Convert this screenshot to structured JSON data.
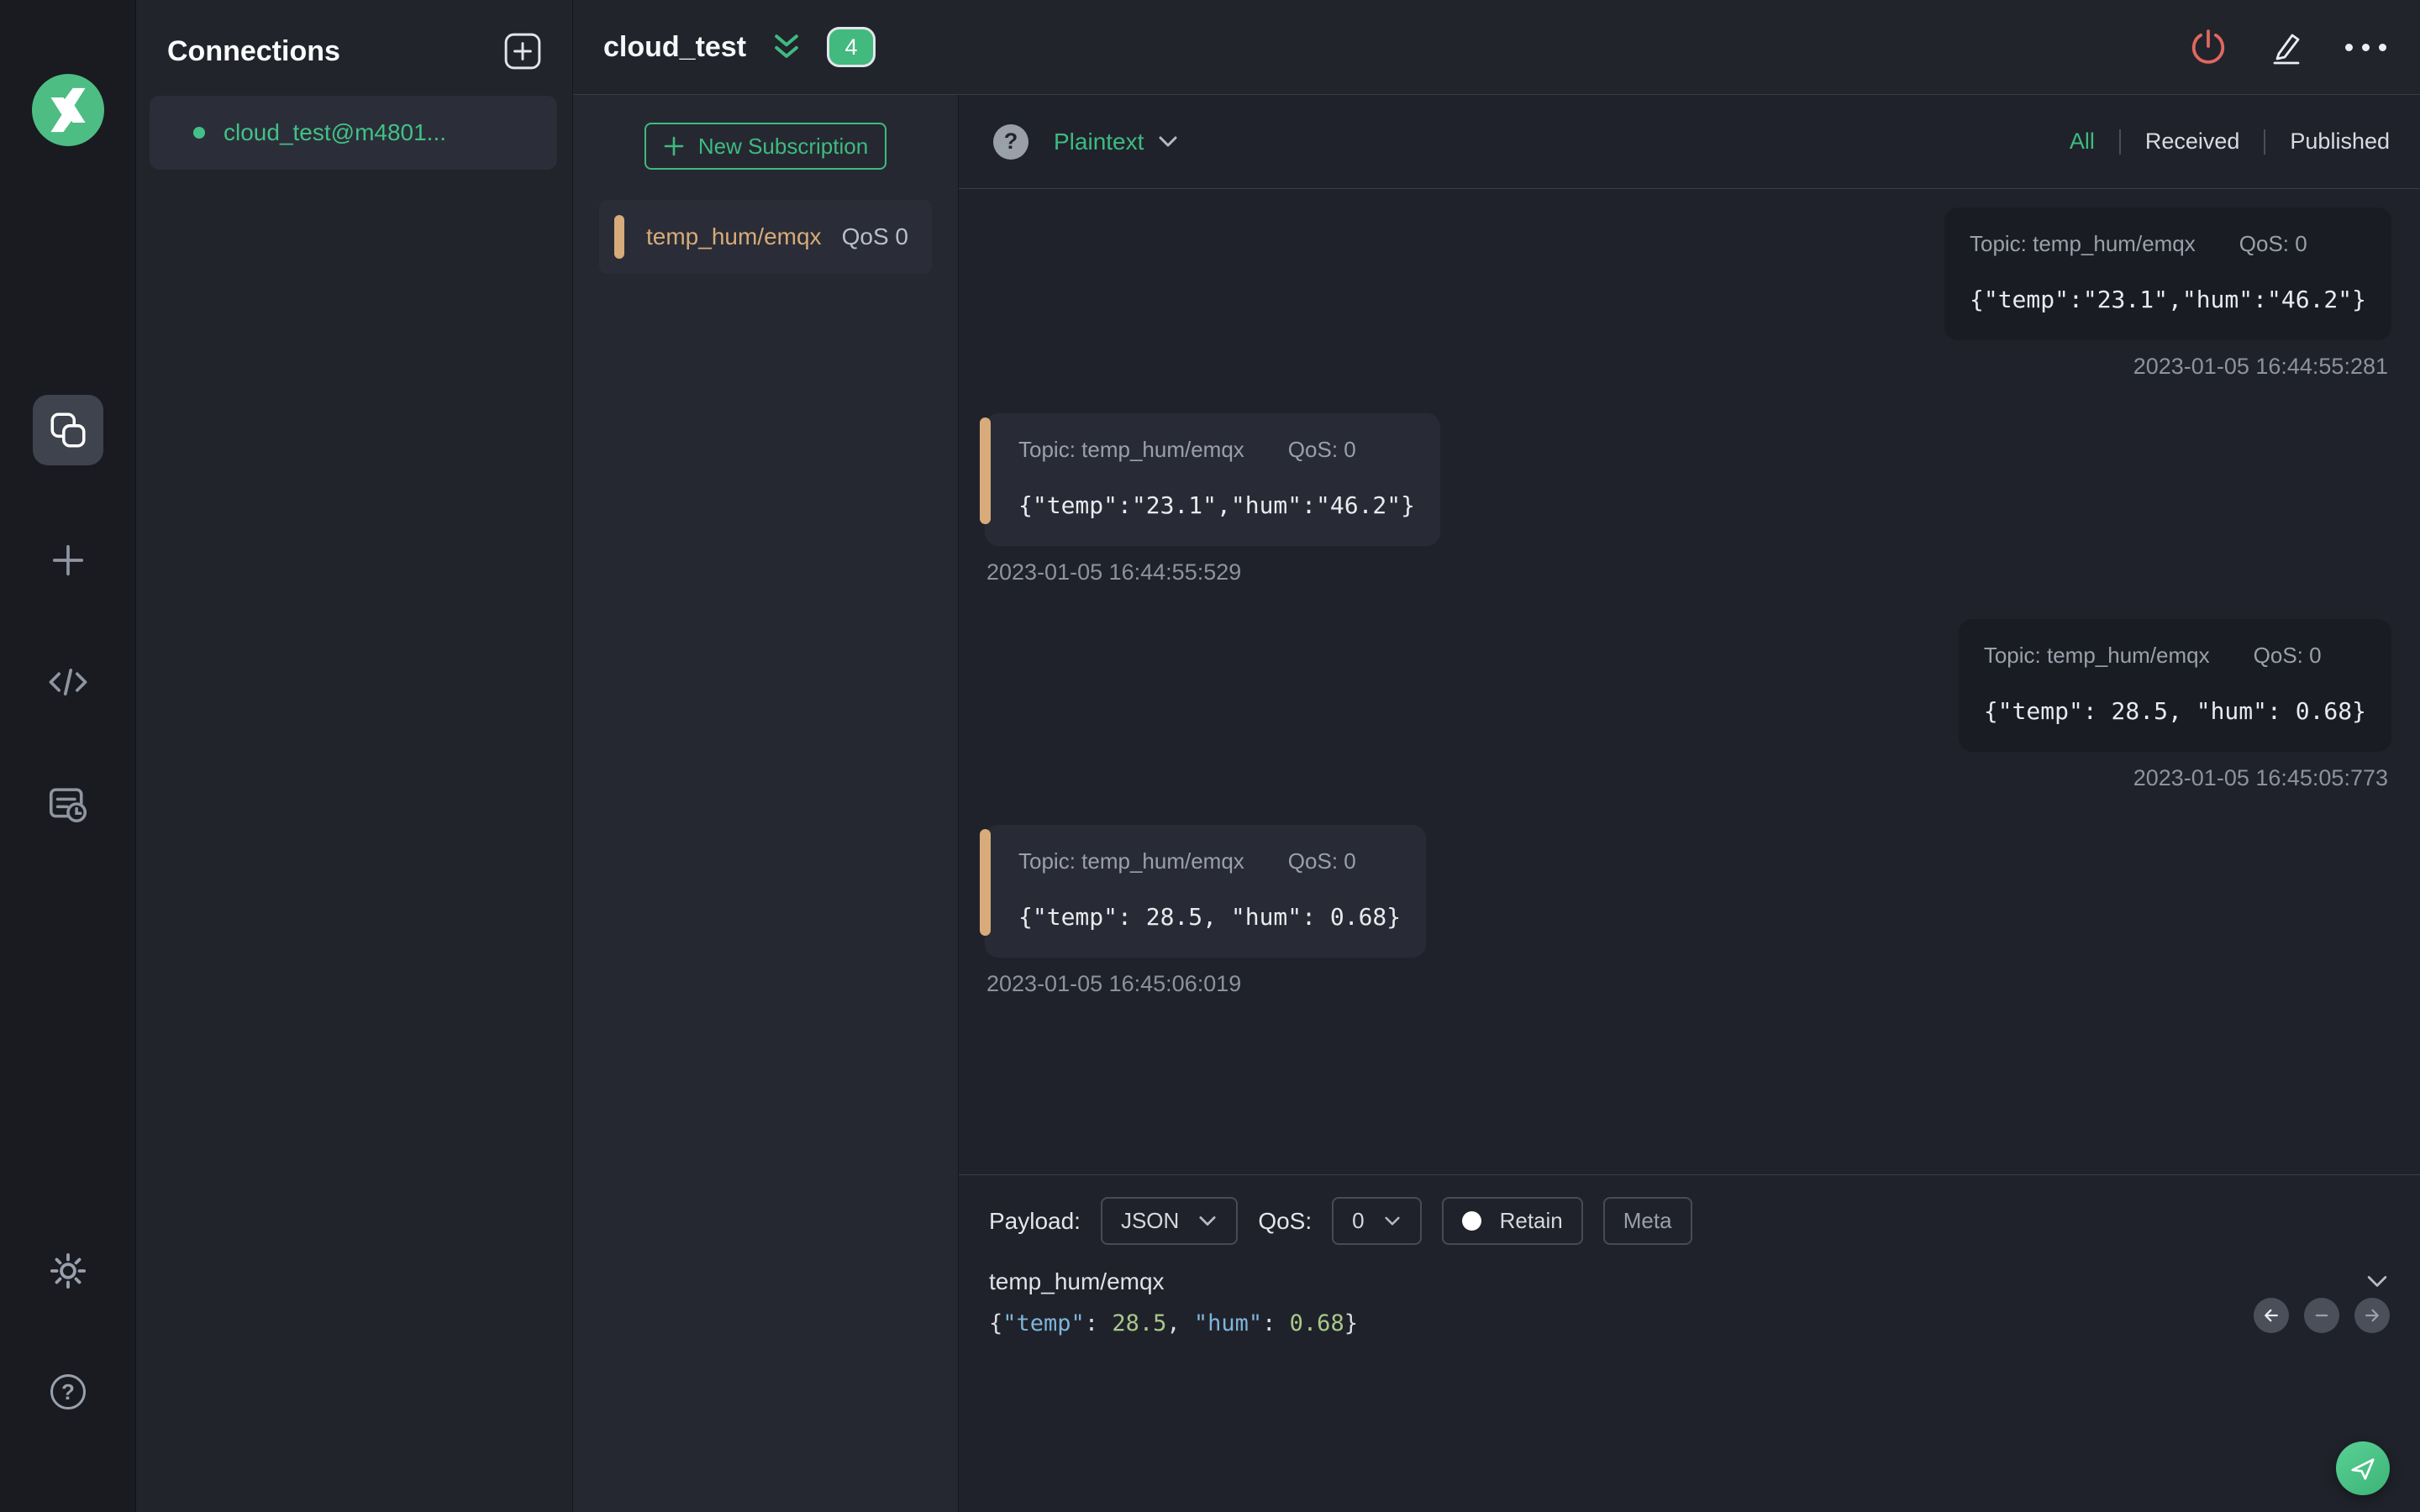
{
  "colors": {
    "accent_green": "#3dbb80",
    "topic_tan": "#d7ab7a",
    "disconnect_coral": "#e0685f",
    "panel_dark": "#20222b"
  },
  "connections_panel": {
    "title": "Connections",
    "items": [
      {
        "label": "cloud_test@m4801...",
        "connected": true,
        "selected": true
      }
    ]
  },
  "header": {
    "title": "cloud_test",
    "badge_count": "4"
  },
  "subscriptions": {
    "new_button_label": "New Subscription",
    "items": [
      {
        "topic": "temp_hum/emqx",
        "qos_label": "QoS 0"
      }
    ]
  },
  "message_toolbar": {
    "format_label": "Plaintext",
    "filters": [
      {
        "label": "All",
        "active": true
      },
      {
        "label": "Received",
        "active": false
      },
      {
        "label": "Published",
        "active": false
      }
    ]
  },
  "messages": [
    {
      "direction": "published",
      "topic_label": "Topic: temp_hum/emqx",
      "qos_label": "QoS: 0",
      "payload": "{\"temp\":\"23.1\",\"hum\":\"46.2\"}",
      "timestamp": "2023-01-05 16:44:55:281"
    },
    {
      "direction": "received",
      "topic_label": "Topic: temp_hum/emqx",
      "qos_label": "QoS: 0",
      "payload": "{\"temp\":\"23.1\",\"hum\":\"46.2\"}",
      "timestamp": "2023-01-05 16:44:55:529"
    },
    {
      "direction": "published",
      "topic_label": "Topic: temp_hum/emqx",
      "qos_label": "QoS: 0",
      "payload": "{\"temp\": 28.5, \"hum\": 0.68}",
      "timestamp": "2023-01-05 16:45:05:773"
    },
    {
      "direction": "received",
      "topic_label": "Topic: temp_hum/emqx",
      "qos_label": "QoS: 0",
      "payload": "{\"temp\": 28.5, \"hum\": 0.68}",
      "timestamp": "2023-01-05 16:45:06:019"
    }
  ],
  "composer": {
    "payload_label": "Payload:",
    "payload_format": "JSON",
    "qos_label": "QoS:",
    "qos_value": "0",
    "retain_label": "Retain",
    "meta_label": "Meta",
    "topic_value": "temp_hum/emqx",
    "payload_code": {
      "brace_open": "{",
      "key1": "\"temp\"",
      "colon1": ": ",
      "val1": "28.5",
      "comma": ", ",
      "key2": "\"hum\"",
      "colon2": ": ",
      "val2": "0.68",
      "brace_close": "}"
    }
  },
  "icons": {
    "question_glyph": "?"
  }
}
